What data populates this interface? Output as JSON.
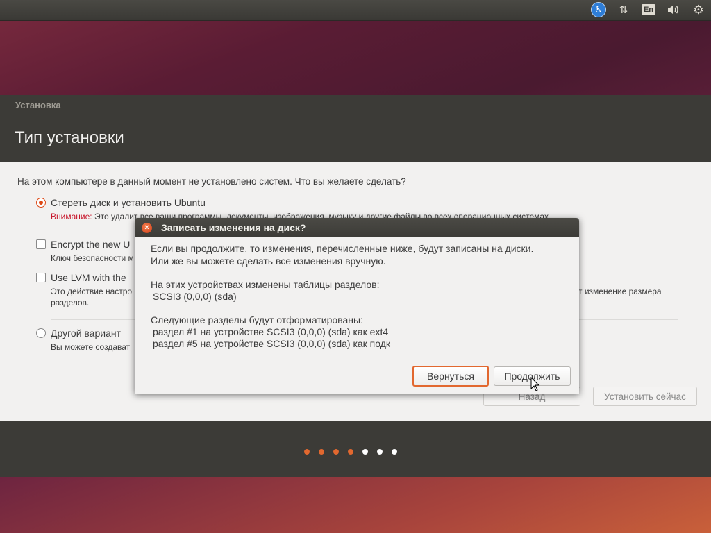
{
  "panel": {
    "language": "En"
  },
  "installer": {
    "window_title": "Установка",
    "heading": "Тип установки",
    "question": "На этом компьютере в данный момент не установлено систем. Что вы желаете сделать?",
    "options": [
      {
        "label": "Стереть диск и установить Ubuntu",
        "selected": true,
        "warning_prefix": "Внимание:",
        "desc": "Это удалит все ваши программы, документы, изображения, музыку и другие файлы во всех операционных системах."
      },
      {
        "label": "Encrypt the new U",
        "desc": "Ключ безопасности м"
      },
      {
        "label": "Use LVM with the",
        "desc_line1": "Это действие настро",
        "desc_line1_right": "т изменение размера",
        "desc_line2": "разделов."
      },
      {
        "label": "Другой вариант",
        "selected": false,
        "desc": "Вы можете создават"
      }
    ],
    "back_button": "Назад",
    "install_button": "Установить сейчас",
    "progress": {
      "total": 7,
      "completed": 4,
      "accent": "#e2682f",
      "inactive": "#ffffff"
    }
  },
  "dialog": {
    "title": "Записать изменения на диск?",
    "intro_line1": "Если вы продолжите, то изменения, перечисленные ниже, будут записаны на диски.",
    "intro_line2": "Или же вы можете сделать все изменения вручную.",
    "tables_header": "На этих устройствах изменены таблицы разделов:",
    "tables_device": "SCSI3 (0,0,0) (sda)",
    "format_header": "Следующие разделы будут отформатированы:",
    "format_items": [
      "раздел #1 на устройстве SCSI3 (0,0,0) (sda) как ext4",
      "раздел #5 на устройстве SCSI3 (0,0,0) (sda) как подк"
    ],
    "back_button": "Вернуться",
    "continue_button": "Продолжить"
  }
}
